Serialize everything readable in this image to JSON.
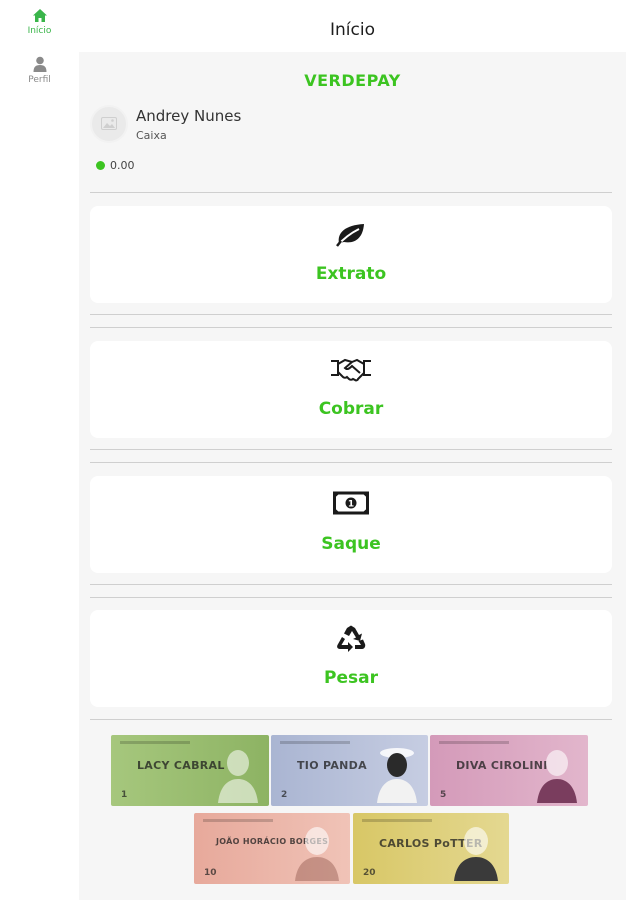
{
  "sidebar": {
    "items": [
      {
        "label": "Início",
        "icon": "home-icon",
        "active": true
      },
      {
        "label": "Perfil",
        "icon": "user-icon",
        "active": false
      }
    ]
  },
  "header": {
    "title": "Início"
  },
  "main": {
    "brand": "VERDEPAY",
    "user": {
      "name": "Andrey Nunes",
      "role": "Caixa"
    },
    "balance": "0.00",
    "actions": [
      {
        "label": "Extrato",
        "icon": "leaf-icon"
      },
      {
        "label": "Cobrar",
        "icon": "handshake-icon"
      },
      {
        "label": "Saque",
        "icon": "money-bill-icon"
      },
      {
        "label": "Pesar",
        "icon": "recycle-icon"
      }
    ],
    "banknotes": [
      {
        "name": "LACY CABRAL",
        "value": "1",
        "color": "#9cbf74"
      },
      {
        "name": "TIO PANDA",
        "value": "2",
        "color": "#b8c1d9"
      },
      {
        "name": "DIVA CIROLINI",
        "value": "5",
        "color": "#d7a3bf"
      },
      {
        "name": "JOÃO HORÁCIO BORGES",
        "value": "10",
        "color": "#e8b4a7"
      },
      {
        "name": "CARLOS PoTTER",
        "value": "20",
        "color": "#dccf72"
      }
    ]
  },
  "colors": {
    "accent": "#3cc421",
    "background": "#f6f6f6",
    "card": "#ffffff"
  }
}
